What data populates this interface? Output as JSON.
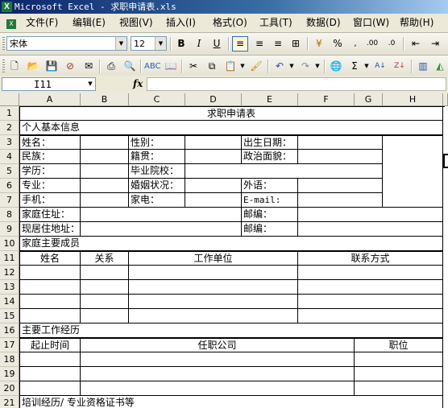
{
  "window": {
    "title": "Microsoft Excel - 求职申请表.xls",
    "app_icon": "excel-icon"
  },
  "menu": [
    "文件(F)",
    "编辑(E)",
    "视图(V)",
    "插入(I)",
    "格式(O)",
    "工具(T)",
    "数据(D)",
    "窗口(W)",
    "帮助(H)"
  ],
  "format_toolbar": {
    "font": "宋体",
    "size": "12"
  },
  "formula_bar": {
    "name_box": "I11",
    "fx_label": "fx",
    "content": ""
  },
  "sheet": {
    "columns": [
      "A",
      "B",
      "C",
      "D",
      "E",
      "F",
      "G",
      "H"
    ],
    "rows": [
      "1",
      "2",
      "3",
      "4",
      "5",
      "6",
      "7",
      "8",
      "9",
      "10",
      "11",
      "12",
      "13",
      "14",
      "15",
      "16",
      "17",
      "18",
      "19",
      "20",
      "21"
    ],
    "cells": {
      "r1_title": "求职申请表",
      "r2_section": "个人基本信息",
      "r3_name": "姓名：",
      "r3_gender": "性别：",
      "r3_birth": "出生日期：",
      "r4_ethnic": "民族：",
      "r4_native": "籍贯：",
      "r4_political": "政治面貌：",
      "r5_education": "学历：",
      "r5_school": "毕业院校：",
      "r6_major": "专业：",
      "r6_marital": "婚姻状况：",
      "r6_language": "外语：",
      "r7_mobile": "手机：",
      "r7_homephone": "家电：",
      "r7_email": "E-mail:",
      "r8_home_address": "家庭住址：",
      "r8_postcode": "邮编：",
      "r9_current_address": "现居住地址：",
      "r9_postcode": "邮编：",
      "r10_family_section": "家庭主要成员",
      "r11_hdr_name": "姓名",
      "r11_hdr_relation": "关系",
      "r11_hdr_employer": "工作单位",
      "r11_hdr_contact": "联系方式",
      "r16_work_section": "主要工作经历",
      "r17_hdr_period": "起止时间",
      "r17_hdr_company": "任职公司",
      "r17_hdr_position": "职位",
      "r21_training_section": "培训经历/ 专业资格证书等"
    }
  }
}
